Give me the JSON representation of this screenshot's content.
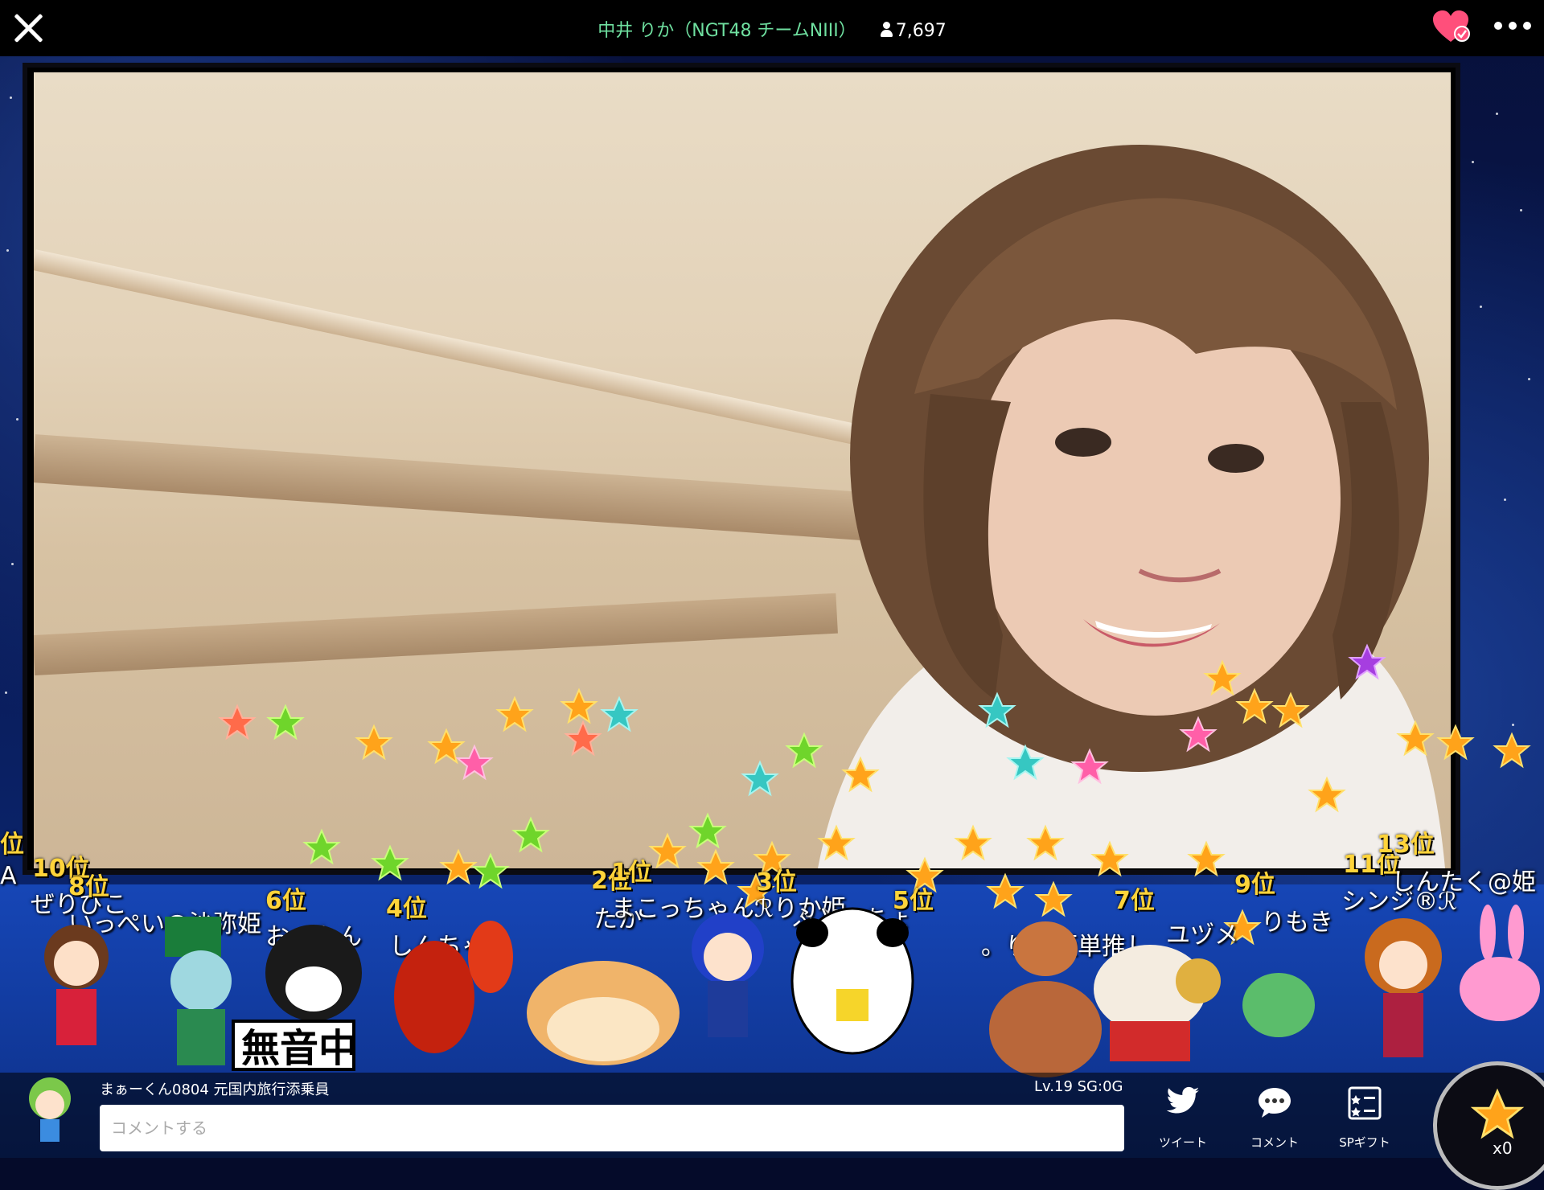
{
  "header": {
    "broadcaster": "中井 りか（NGT48 チームNIII）",
    "viewer_count": "7,697"
  },
  "rankings": [
    {
      "rank": "位",
      "name": "A"
    },
    {
      "rank": "10位",
      "name": "ぜりびこ"
    },
    {
      "rank": "8位",
      "name": "いっぺい@沙弥姫"
    },
    {
      "rank": "6位",
      "name": "おーたん"
    },
    {
      "rank": "4位",
      "name": "しんちゃん"
    },
    {
      "rank": "2位",
      "name": "たか"
    },
    {
      "rank": "1位",
      "name": "まこっちゃんℛりか姫"
    },
    {
      "rank": "3位",
      "name": "ふとっちょ"
    },
    {
      "rank": "5位",
      "name": "。りか姫単推し"
    },
    {
      "rank": "7位",
      "name": "ユヅメ"
    },
    {
      "rank": "9位",
      "name": "りもき"
    },
    {
      "rank": "11位",
      "name": "シンジ®ℛ"
    },
    {
      "rank": "13位",
      "name": "しんたく@姫"
    }
  ],
  "stage_sign": "無音中",
  "footer": {
    "current_user": "まぁーくん0804 元国内旅行添乗員",
    "level": "Lv.19  SG:0G",
    "comment_placeholder": "コメントする",
    "tweet_label": "ツイート",
    "comment_label": "コメント",
    "sp_gift_label": "SPギフト",
    "star_count": "x0"
  },
  "colors": {
    "accent_green": "#6fe0a0",
    "heart_pink": "#ff4f7b",
    "rank_gold": "#ffd43a"
  },
  "icons": [
    "close-icon",
    "viewer-icon",
    "heart-icon",
    "more-icon",
    "twitter-icon",
    "comment-icon",
    "sp-gift-icon",
    "star-icon"
  ]
}
